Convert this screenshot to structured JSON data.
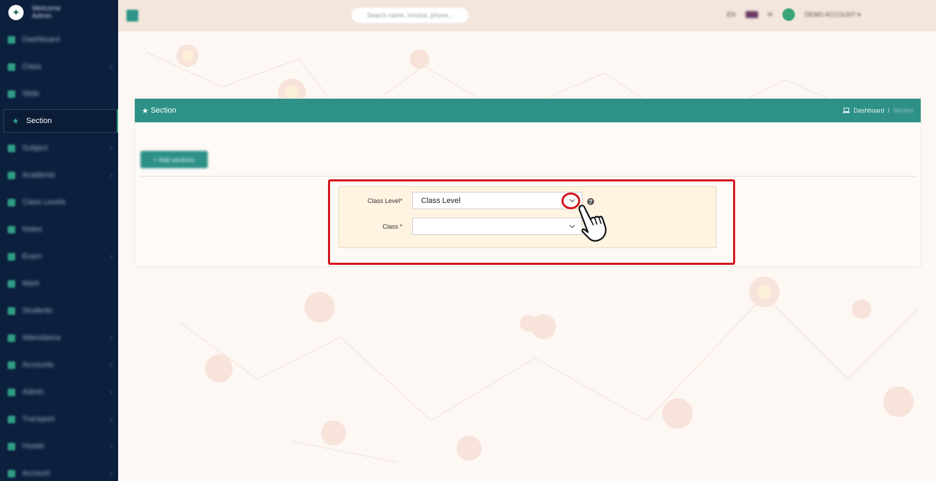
{
  "sidebar": {
    "welcome": "Welcome",
    "user": "Admin",
    "items": [
      {
        "label": "Dashboard",
        "caret": ""
      },
      {
        "label": "Class",
        "caret": "›"
      },
      {
        "label": "Slide",
        "caret": ""
      },
      {
        "label": "Section",
        "caret": ""
      },
      {
        "label": "Subject",
        "caret": "›"
      },
      {
        "label": "Academic",
        "caret": "›"
      },
      {
        "label": "Class Levels",
        "caret": ""
      },
      {
        "label": "Notes",
        "caret": ""
      },
      {
        "label": "Exam",
        "caret": "‹"
      },
      {
        "label": "Mark",
        "caret": ""
      },
      {
        "label": "Students",
        "caret": ""
      },
      {
        "label": "Attendance",
        "caret": "‹"
      },
      {
        "label": "Accounts",
        "caret": "‹"
      },
      {
        "label": "Admin",
        "caret": "‹"
      },
      {
        "label": "Transport",
        "caret": "‹"
      },
      {
        "label": "Hostel",
        "caret": "‹"
      },
      {
        "label": "Account",
        "caret": "‹"
      }
    ]
  },
  "header": {
    "search_placeholder": "Search name, invoice, phone...",
    "lang_code": "EN",
    "msg_icon": "✉",
    "account_label": "DEMO ACCOUNT ▾"
  },
  "page": {
    "title": "Section",
    "breadcrumb_home": "Dashboard",
    "breadcrumb_sep": "/",
    "breadcrumb_current": "Section",
    "add_button": "+ Add sections"
  },
  "form": {
    "class_level_label": "Class Level*",
    "class_level_value": "Class Level",
    "class_label": "Class *",
    "class_value": "",
    "help_glyph": "?"
  },
  "colors": {
    "sidebar_bg": "#0c1f3d",
    "accent": "#2e9188",
    "highlight": "#d4141c"
  }
}
